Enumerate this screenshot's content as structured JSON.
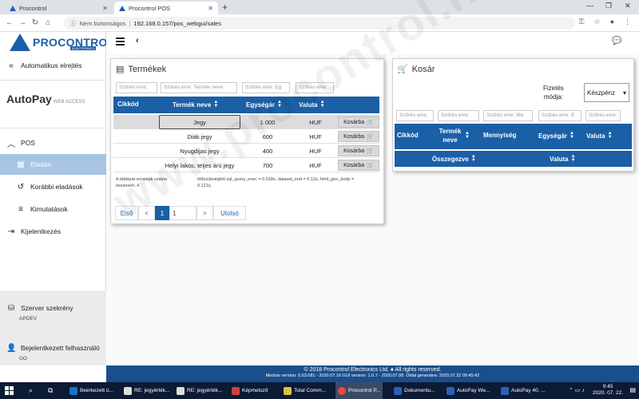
{
  "browser": {
    "tabs": [
      {
        "label": "Procontrol"
      },
      {
        "label": "Procontrol POS"
      }
    ],
    "security_label": "Nem biztonságos",
    "url": "192.168.0.157/pos_webgui/sales"
  },
  "sidebar": {
    "logo_text": "PROCONTROL",
    "logo_sub": "ELECTRONICS",
    "auto_logout": "Automatikus elrejtés",
    "autopay_brand": "AutoPay",
    "autopay_sub": "WEB ACCESS",
    "pos_group": "POS",
    "items": [
      {
        "label": "Eladás"
      },
      {
        "label": "Korábbi eladások"
      },
      {
        "label": "Kimutatások"
      }
    ],
    "logout": "Kijelentkezés",
    "server_label": "Szerver szekrény",
    "server_value": "APDEV",
    "user_label": "Bejelentkezett felhasználó",
    "user_value": "GO"
  },
  "products": {
    "title": "Termékek",
    "filters": [
      "Szűrés erre:",
      "Szűrés erre: Termék neve",
      "Szűrés erre: Eg",
      "Szűrés erre:"
    ],
    "headers": [
      "Cikkód",
      "Termék neve",
      "Egységár",
      "Valuta"
    ],
    "rows": [
      {
        "name": "Jegy",
        "price": "1 000",
        "currency": "HUF",
        "action": "Kosárba"
      },
      {
        "name": "Diák jegy",
        "price": "600",
        "currency": "HUF",
        "action": "Kosárba"
      },
      {
        "name": "Nyugdíjas jegy",
        "price": "400",
        "currency": "HUF",
        "action": "Kosárba"
      },
      {
        "name": "Helyi lakos, teljes árú jegy",
        "price": "700",
        "currency": "HUF",
        "action": "Kosárba"
      }
    ],
    "info_left_1": "A táblázat sorainak száma",
    "info_left_2": "összesen: 4",
    "info_right_1": "Időszükségleti sql_query_exec = 0.018s, dataset_end = 0.12s, html_gen_body =",
    "info_right_2": "0.121s,",
    "pager": {
      "first": "Első",
      "prev": "<",
      "page": "1",
      "page_input": "1",
      "next": ">",
      "last": "Utolsó"
    }
  },
  "cart": {
    "title": "Kosár",
    "payment_label_1": "Fizetés",
    "payment_label_2": "módja:",
    "payment_value": "Készpénz",
    "filters": [
      "Szűrés erre:",
      "Szűrés erre:",
      "Szűrés erre: Me",
      "Szűrés erre: E",
      "Szűrés erre:"
    ],
    "headers": [
      "Cikkód",
      "Termék neve",
      "Mennyiség",
      "Egységár",
      "Valuta"
    ],
    "footer_headers": [
      "Összegezve",
      "Valuta"
    ]
  },
  "footer": {
    "line1": "© 2018 Procontrol Electronics Ltd. ● All rights reserved.",
    "line2": "Module version: 5.63.081 - 2020.07.16     GUI version: 1.0.7 - 2020.07.08.     Oldal generálva: 2020.07.22 09:45:42"
  },
  "taskbar": {
    "items": [
      {
        "label": "Beérkezett ü..."
      },
      {
        "label": "RE: jegyérték..."
      },
      {
        "label": "RE: jegyérték..."
      },
      {
        "label": "Képmetsző"
      },
      {
        "label": "Total Comm..."
      },
      {
        "label": "Procontrol P..."
      },
      {
        "label": "Dokumentu..."
      },
      {
        "label": "AutoPay We..."
      },
      {
        "label": "AutoPay 40, ..."
      }
    ],
    "time": "9:45",
    "date": "2020. 07. 22."
  },
  "watermark": "www.procontrol.hu",
  "colors": {
    "accent": "#1b5fa7",
    "active_side": "#a7c4e4",
    "footer": "#1b4e8d",
    "taskbar": "#0c1a33"
  }
}
